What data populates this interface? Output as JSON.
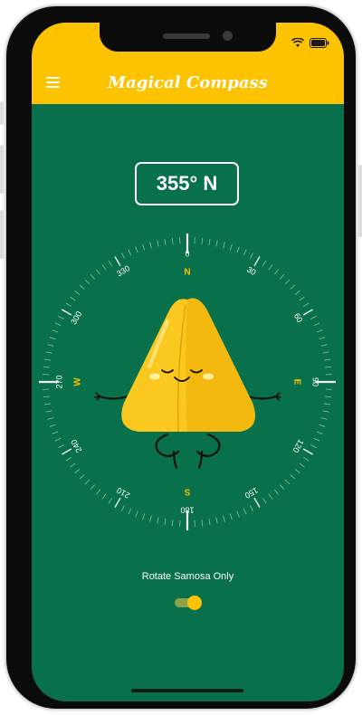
{
  "app": {
    "title": "Magical Compass",
    "menu_icon": "hamburger-menu-icon"
  },
  "status_bar": {
    "icons": [
      "wifi-icon",
      "battery-icon"
    ]
  },
  "heading": {
    "display": "355° N"
  },
  "compass": {
    "cardinals": {
      "north": "N",
      "east": "E",
      "south": "S",
      "west": "W"
    },
    "degree_labels": [
      "0",
      "30",
      "60",
      "90",
      "120",
      "150",
      "180",
      "210",
      "240",
      "270",
      "300",
      "330"
    ],
    "mascot": "samosa-character"
  },
  "toggle": {
    "label": "Rotate Samosa Only",
    "state": "on"
  },
  "colors": {
    "background": "#08704a",
    "appbar": "#fdc300",
    "accent": "#fdc300",
    "samosa": "#fdd237"
  }
}
